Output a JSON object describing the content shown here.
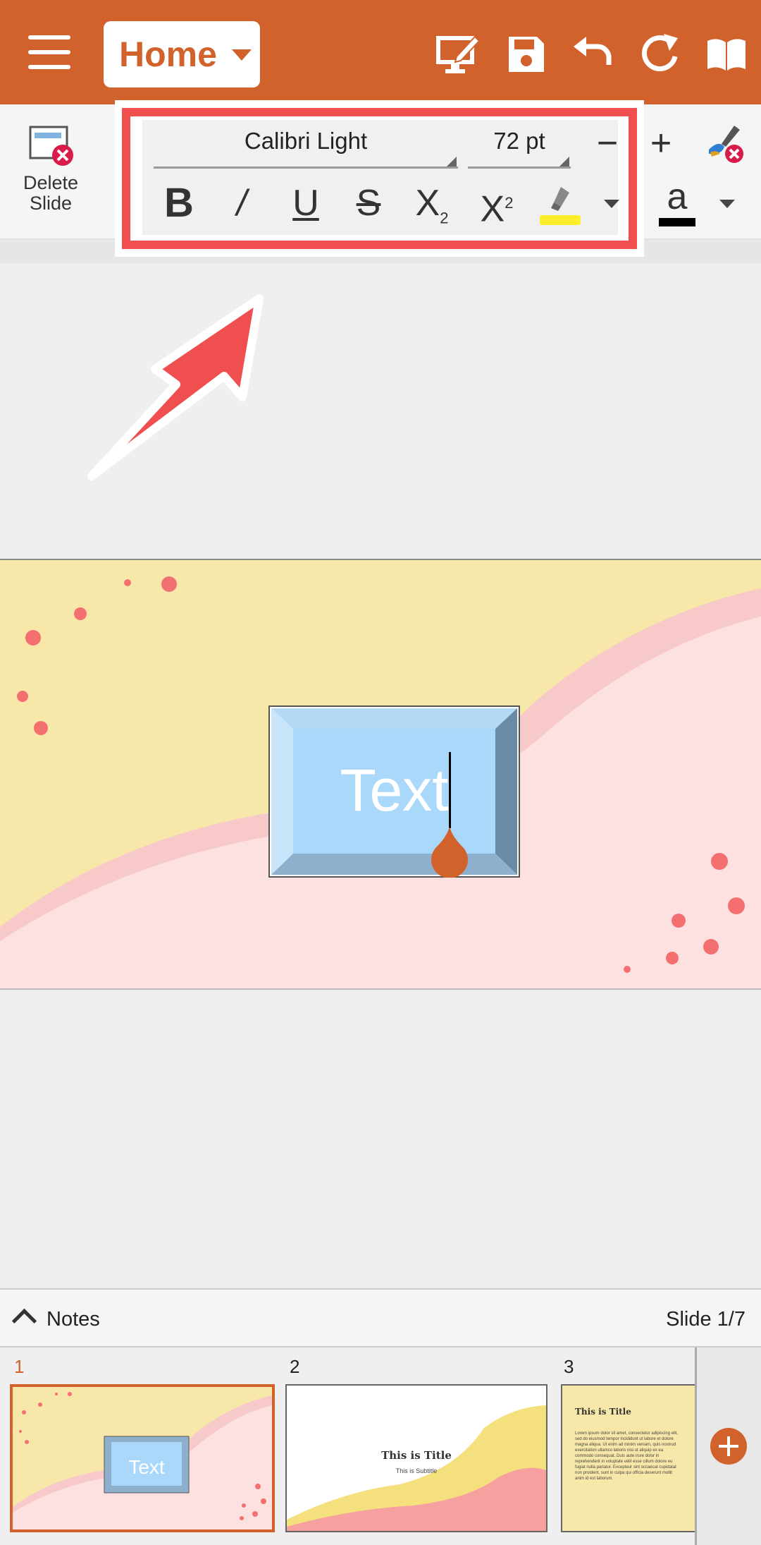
{
  "app": {
    "menu_label": "Home",
    "accent": "#d1622b"
  },
  "toolbar": {
    "icons": [
      "menu-icon",
      "edit-slide-icon",
      "save-icon",
      "undo-icon",
      "redo-icon",
      "read-mode-icon"
    ]
  },
  "ribbon": {
    "delete_slide_line1": "Delete",
    "delete_slide_line2": "Slide",
    "font_name": "Calibri Light",
    "font_size": "72 pt",
    "decrease_label": "−",
    "increase_label": "+",
    "bold_label": "B",
    "italic_label": "/",
    "underline_label": "U",
    "strike_label": "S",
    "subscript_label": "X",
    "subscript_sup": "2",
    "superscript_label": "X",
    "superscript_sup": "2",
    "highlight_color": "#ffef2a",
    "font_color_label": "a",
    "font_color": "#000000"
  },
  "slide": {
    "textbox_text": "Text"
  },
  "notes": {
    "label": "Notes",
    "slide_counter": "Slide 1/7"
  },
  "thumbnails": [
    {
      "number": "1",
      "text": "Text"
    },
    {
      "number": "2",
      "title": "This is Title",
      "subtitle": "This is Subtitle"
    },
    {
      "number": "3",
      "title": "This is Title",
      "body": "Lorem ipsum dolor sit amet, consectetur adipiscing elit, sed do eiusmod tempor incididunt ut labore et dolore magna aliqua. Ut enim ad minim veniam, quis nostrud exercitation ullamco laboris nisi ut aliquip ex ea commodo consequat. Duis aute irure dolor in reprehenderit in voluptate velit esse cillum dolore eu fugiat nulla pariatur. Excepteur sint occaecat cupidatat non proident, sunt in culpa qui officia deserunt mollit anim id est laborum."
    }
  ]
}
